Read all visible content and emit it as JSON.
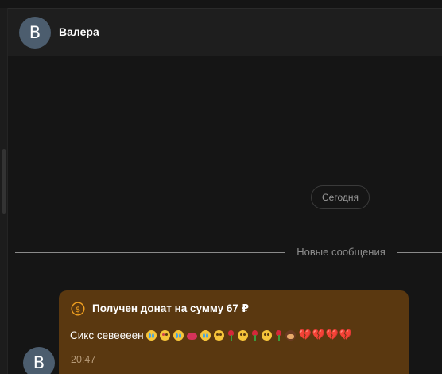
{
  "header": {
    "avatar_letter": "В",
    "contact_name": "Валера"
  },
  "chat": {
    "date_label": "Сегодня",
    "new_messages_label": "Новые сообщения"
  },
  "message": {
    "avatar_letter": "В",
    "donation_title": "Получен донат на сумму 67 ₽",
    "text": "Сикс севеееен",
    "emojis": [
      "loudly-crying-face",
      "face-blowing-kiss",
      "loudly-crying-face",
      "kiss-mark",
      "loudly-crying-face",
      "smiling-face-with-heart-eyes",
      "rose",
      "smiling-face-with-heart-eyes",
      "rose",
      "smiling-face-with-heart-eyes",
      "rose",
      "shy-face",
      "broken-heart",
      "broken-heart",
      "broken-heart",
      "broken-heart"
    ],
    "time": "20:47"
  },
  "colors": {
    "background": "#151515",
    "header": "#1e1e1e",
    "avatar": "#4c5d6e",
    "donation_bubble": "#5a3810",
    "donation_icon": "#f0a020"
  }
}
